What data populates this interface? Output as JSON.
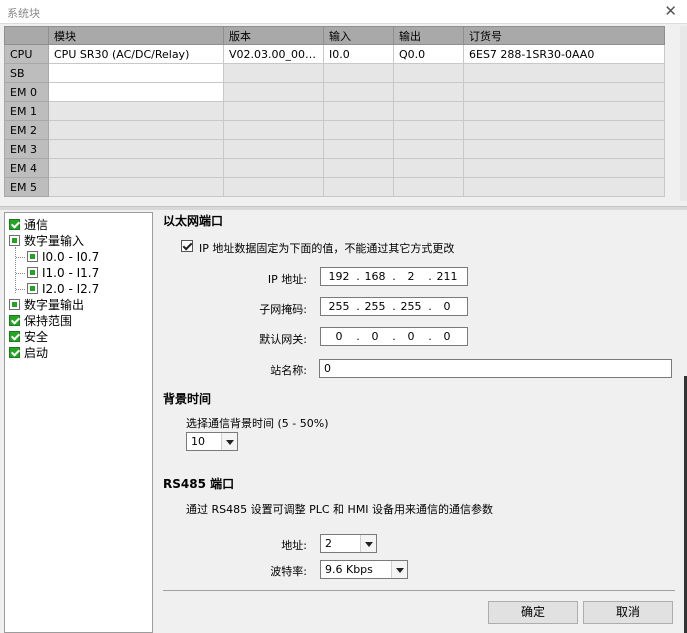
{
  "window": {
    "title": "系统块",
    "close_glyph": "✕"
  },
  "module_table": {
    "columns": [
      "",
      "模块",
      "版本",
      "输入",
      "输出",
      "订货号"
    ],
    "rows": [
      {
        "slot": "CPU",
        "module": "CPU SR30 (AC/DC/Relay)",
        "version": "V02.03.00_00.00...",
        "input": "I0.0",
        "output": "Q0.0",
        "order": "6ES7 288-1SR30-0AA0"
      },
      {
        "slot": "SB",
        "module": "",
        "version": "",
        "input": "",
        "output": "",
        "order": ""
      },
      {
        "slot": "EM 0",
        "module": "",
        "version": "",
        "input": "",
        "output": "",
        "order": ""
      },
      {
        "slot": "EM 1",
        "module": "",
        "version": "",
        "input": "",
        "output": "",
        "order": ""
      },
      {
        "slot": "EM 2",
        "module": "",
        "version": "",
        "input": "",
        "output": "",
        "order": ""
      },
      {
        "slot": "EM 3",
        "module": "",
        "version": "",
        "input": "",
        "output": "",
        "order": ""
      },
      {
        "slot": "EM 4",
        "module": "",
        "version": "",
        "input": "",
        "output": "",
        "order": ""
      },
      {
        "slot": "EM 5",
        "module": "",
        "version": "",
        "input": "",
        "output": "",
        "order": ""
      }
    ]
  },
  "tree": {
    "items": [
      {
        "label": "通信",
        "state": "checked"
      },
      {
        "label": "数字量输入",
        "state": "partial"
      },
      {
        "label": "I0.0 - I0.7",
        "state": "partial"
      },
      {
        "label": "I1.0 - I1.7",
        "state": "partial"
      },
      {
        "label": "I2.0 - I2.7",
        "state": "partial"
      },
      {
        "label": "数字量输出",
        "state": "partial"
      },
      {
        "label": "保持范围",
        "state": "checked"
      },
      {
        "label": "安全",
        "state": "checked"
      },
      {
        "label": "启动",
        "state": "checked"
      }
    ]
  },
  "ethernet": {
    "heading": "以太网端口",
    "fixed_ip_label": "IP 地址数据固定为下面的值，不能通过其它方式更改",
    "ip_label": "IP 地址:",
    "ip": [
      "192",
      "168",
      "2",
      "211"
    ],
    "mask_label": "子网掩码:",
    "mask": [
      "255",
      "255",
      "255",
      "0"
    ],
    "gateway_label": "默认网关:",
    "gateway": [
      "0",
      "0",
      "0",
      "0"
    ],
    "station_label": "站名称:",
    "station_value": "0"
  },
  "background": {
    "heading": "背景时间",
    "select_label": "选择通信背景时间 (5 - 50%)",
    "value": "10"
  },
  "rs485": {
    "heading": "RS485 端口",
    "description": "通过 RS485 设置可调整 PLC 和 HMI 设备用来通信的通信参数",
    "address_label": "地址:",
    "address_value": "2",
    "baud_label": "波特率:",
    "baud_value": "9.6 Kbps"
  },
  "buttons": {
    "ok": "确定",
    "cancel": "取消"
  },
  "colors": {
    "header": "#a9a9a9",
    "slot": "#bdbdbd",
    "check_green": "#22a522"
  }
}
